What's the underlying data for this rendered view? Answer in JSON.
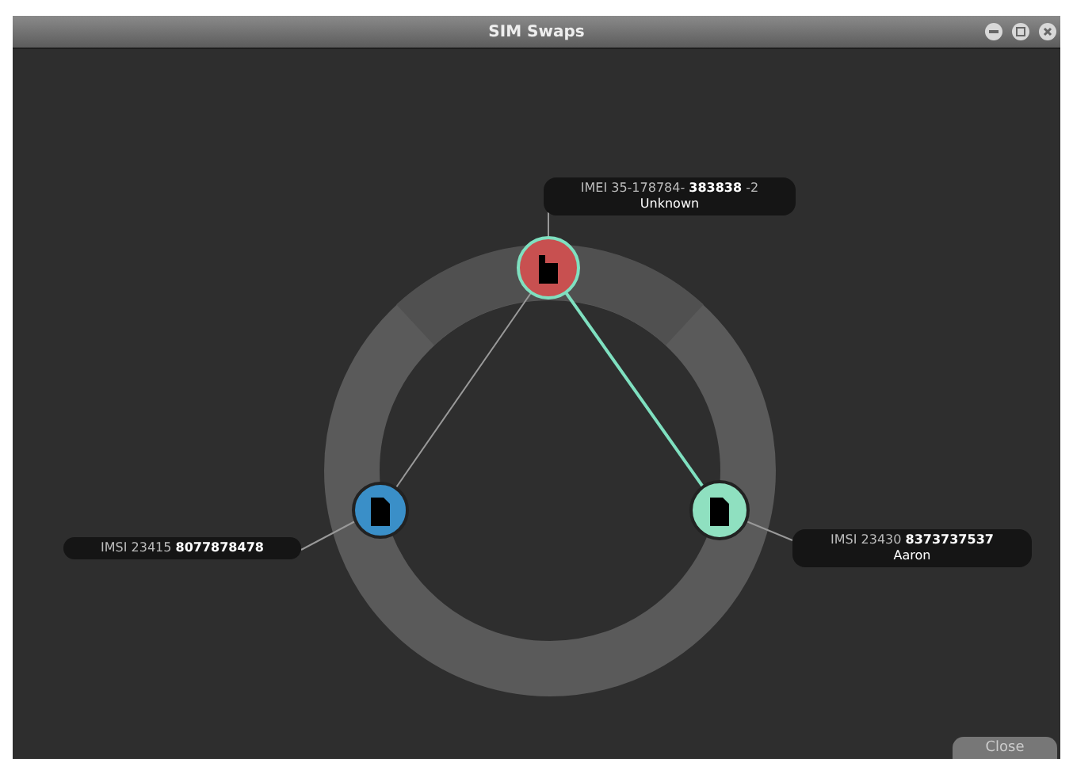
{
  "window": {
    "title": "SIM Swaps"
  },
  "device": {
    "kind": "phone",
    "color": "#c85050",
    "selected": true,
    "label": "IMEI 35-178784- **383838** -2",
    "sublabel": "Unknown"
  },
  "sims": [
    {
      "kind": "sim",
      "color": "#3a8fc8",
      "selected": false,
      "highlighted": false,
      "label": "IMSI 23415 **8077878478**"
    },
    {
      "kind": "sim",
      "color": "#8fe0c0",
      "selected": false,
      "highlighted": true,
      "label": "IMSI 23430 **8373737537**",
      "sublabel": "Aaron"
    }
  ],
  "buttons": [
    {
      "label": "Close"
    }
  ]
}
